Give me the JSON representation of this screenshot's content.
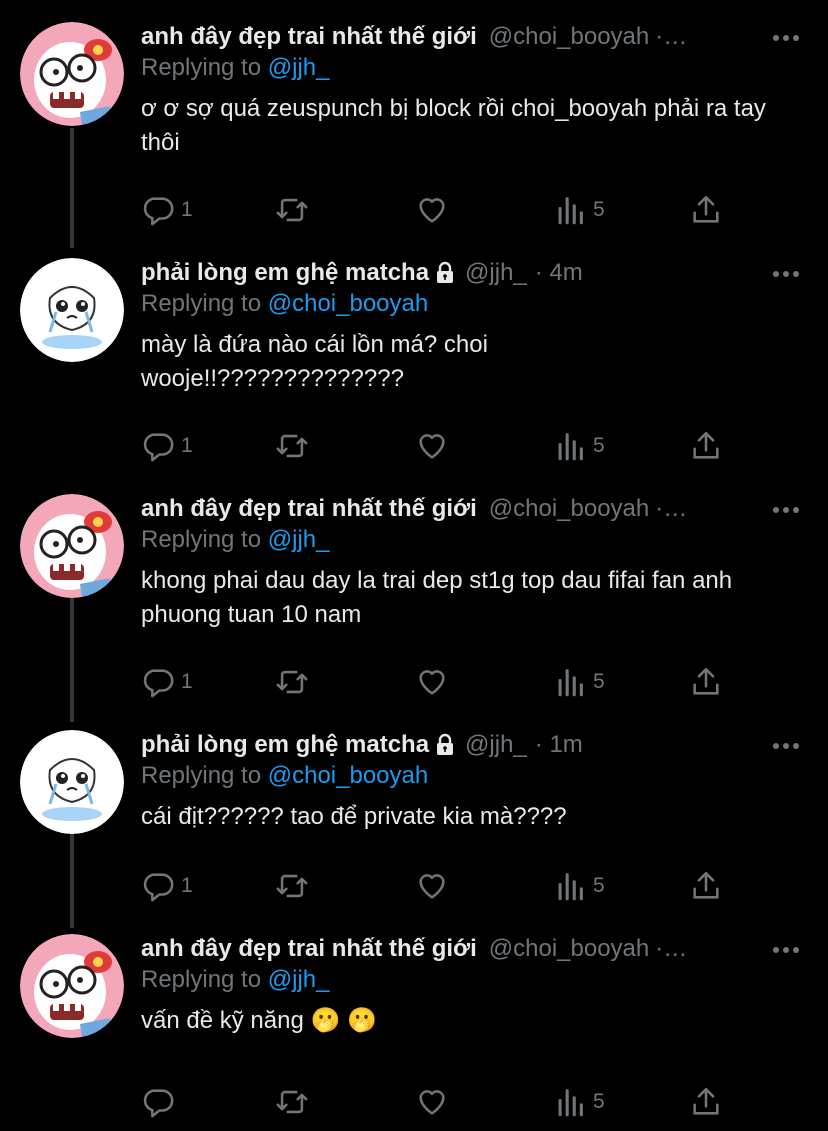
{
  "thread": [
    {
      "author_name": "anh đây đẹp trai nhất thế giới",
      "handle": "@choi_booyah",
      "meta": "·…",
      "locked": false,
      "avatar": "zombie-hellokitty-avatar",
      "replying_label": "Replying to",
      "replying_to": "@jjh_",
      "text": "ơ ơ sợ quá zeuspunch bị block rồi choi_booyah phải ra tay thôi",
      "replies": "1",
      "retweets": "",
      "likes": "",
      "views": "5"
    },
    {
      "author_name": "phải lòng em ghệ matcha",
      "handle": "@jjh_",
      "meta": "· 4m",
      "locked": true,
      "avatar": "crying-doodle-avatar",
      "replying_label": "Replying to",
      "replying_to": "@choi_booyah",
      "text": "mày là đứa nào cái lồn má? choi wooje!!??????????????",
      "replies": "1",
      "retweets": "",
      "likes": "",
      "views": "5"
    },
    {
      "author_name": "anh đây đẹp trai nhất thế giới",
      "handle": "@choi_booyah",
      "meta": "·…",
      "locked": false,
      "avatar": "zombie-hellokitty-avatar",
      "replying_label": "Replying to",
      "replying_to": "@jjh_",
      "text": "khong phai dau day la trai dep st1g top dau fifai fan anh phuong tuan 10 nam",
      "replies": "1",
      "retweets": "",
      "likes": "",
      "views": "5"
    },
    {
      "author_name": "phải lòng em ghệ matcha",
      "handle": "@jjh_",
      "meta": "· 1m",
      "locked": true,
      "avatar": "crying-doodle-avatar",
      "replying_label": "Replying to",
      "replying_to": "@choi_booyah",
      "text": "cái địt?????? tao để private kia mà????",
      "replies": "1",
      "retweets": "",
      "likes": "",
      "views": "5"
    },
    {
      "author_name": "anh đây đẹp trai nhất thế giới",
      "handle": "@choi_booyah",
      "meta": "·…",
      "locked": false,
      "avatar": "zombie-hellokitty-avatar",
      "replying_label": "Replying to",
      "replying_to": "@jjh_",
      "text": "vấn đề kỹ năng 🫢 🫢",
      "replies": "",
      "retweets": "",
      "likes": "",
      "views": "5"
    }
  ],
  "colors": {
    "background": "#000000",
    "text": "#e7e9ea",
    "secondary": "#71767b",
    "accent": "#1d9bf0",
    "thread_line": "#333639"
  },
  "icons": [
    "reply-icon",
    "retweet-icon",
    "like-icon",
    "views-icon",
    "share-icon",
    "more-icon",
    "lock-icon"
  ]
}
